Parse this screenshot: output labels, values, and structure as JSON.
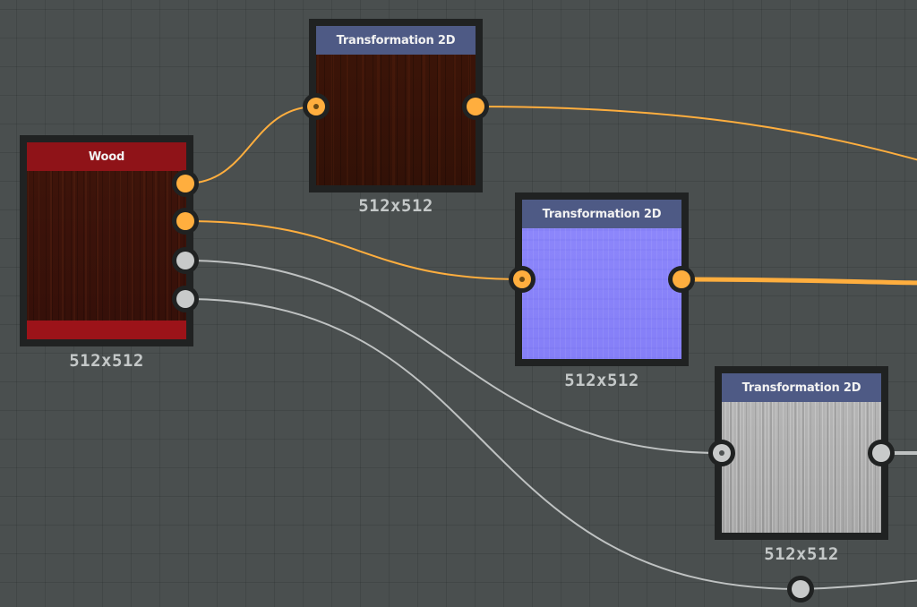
{
  "colors": {
    "canvas": "#4a4f4f",
    "wood_header": "#8f1318",
    "transform_header": "#4e5a85",
    "port_color_wire": "#ffae3e",
    "port_gray": "#c8caca",
    "node_frame": "#202222",
    "size_label": "#c4c8c8"
  },
  "nodes": {
    "wood": {
      "title": "Wood",
      "size": "512x512",
      "thumbnail": "wood-texture",
      "outputs": [
        "color",
        "color",
        "grayscale",
        "grayscale"
      ]
    },
    "transform_a": {
      "title": "Transformation 2D",
      "size": "512x512",
      "thumbnail": "wood-texture"
    },
    "transform_b": {
      "title": "Transformation 2D",
      "size": "512x512",
      "thumbnail": "normal-map"
    },
    "transform_c": {
      "title": "Transformation 2D",
      "size": "512x512",
      "thumbnail": "grayscale-roughness"
    }
  },
  "connections": [
    {
      "from": "wood.out1",
      "to": "transform_a.in",
      "type": "color"
    },
    {
      "from": "wood.out2",
      "to": "transform_b.in",
      "type": "color"
    },
    {
      "from": "wood.out3",
      "to": "transform_c.in",
      "type": "grayscale"
    },
    {
      "from": "wood.out4",
      "to": "offscreen-node.in",
      "type": "grayscale"
    },
    {
      "from": "transform_a.out",
      "to": "offscreen",
      "type": "color"
    },
    {
      "from": "transform_b.out",
      "to": "offscreen",
      "type": "color"
    },
    {
      "from": "transform_c.out",
      "to": "offscreen",
      "type": "grayscale"
    }
  ]
}
